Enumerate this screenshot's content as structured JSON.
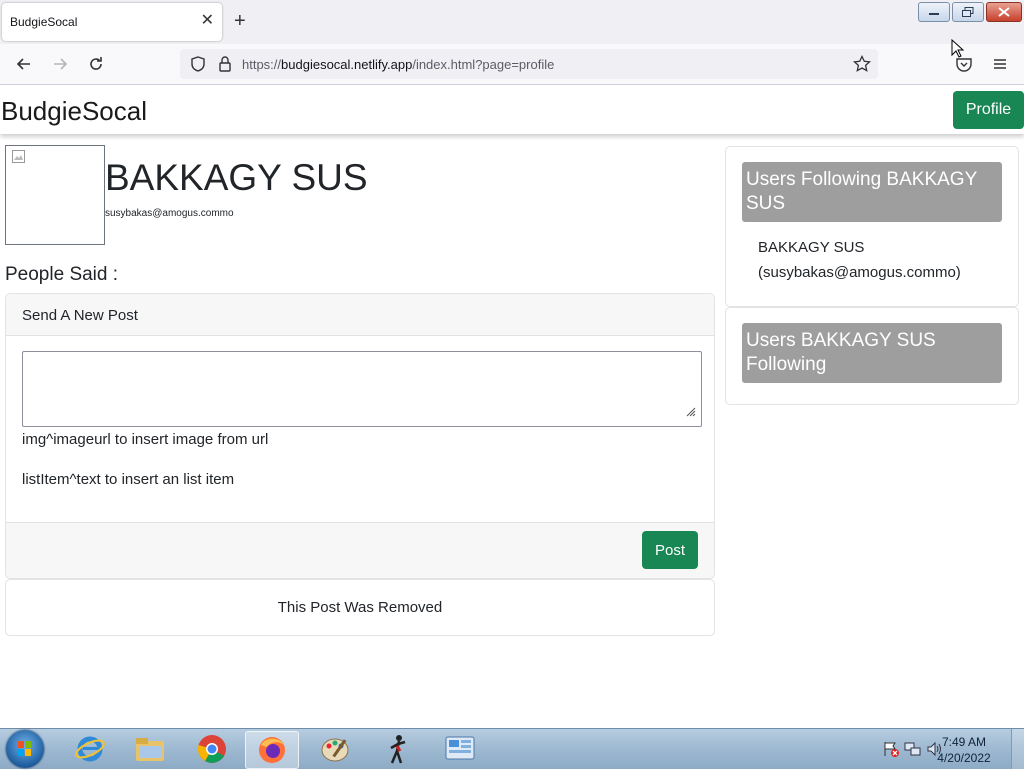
{
  "browser": {
    "tab_title": "BudgieSocal",
    "tab_close": "✕",
    "new_tab": "+",
    "url_prefix": "https://",
    "url_host": "budgiesocal.netlify.app",
    "url_path": "/index.html?page=profile"
  },
  "site": {
    "brand": "BudgieSocal",
    "profile_button": "Profile"
  },
  "profile": {
    "name": "BAKKAGY SUS",
    "email": "susybakas@amogus.commo",
    "people_said": "People Said :"
  },
  "new_post": {
    "header": "Send A New Post",
    "input_value": "",
    "hint_image": "img^imageurl to insert image from url",
    "hint_list": "listItem^text to insert an list item",
    "post_button": "Post"
  },
  "posts": [
    {
      "text": "This Post Was Removed"
    }
  ],
  "sidebar": {
    "followers_title": "Users Following BAKKAGY SUS",
    "followers": [
      {
        "name": "BAKKAGY SUS",
        "email": "(susybakas@amogus.commo)"
      }
    ],
    "following_title": "Users BAKKAGY SUS Following"
  },
  "taskbar": {
    "time": "7:49 AM",
    "date": "4/20/2022"
  },
  "colors": {
    "accent_green": "#198754",
    "sidebar_header_gray": "#9e9e9e"
  }
}
